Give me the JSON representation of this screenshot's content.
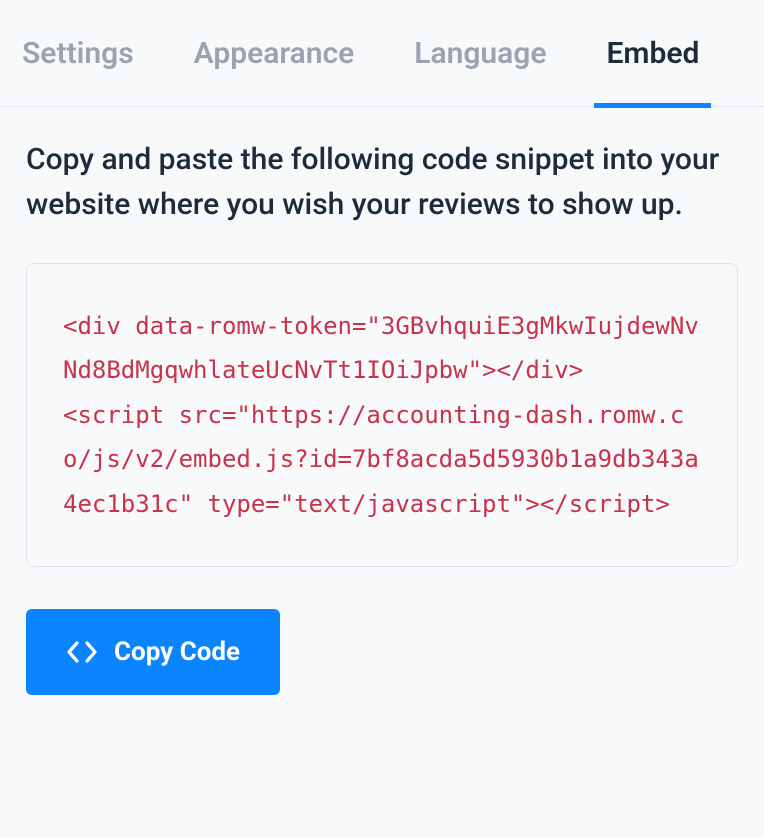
{
  "tabs": {
    "settings": "Settings",
    "appearance": "Appearance",
    "language": "Language",
    "embed": "Embed"
  },
  "instructions": "Copy and paste the following code snippet into your website where you wish your reviews to show up.",
  "code_snippet": "<div data-romw-token=\"3GBvhquiE3gMkwIujdewNvNd8BdMgqwhlateUcNvTt1IOiJpbw\"></div>\n<script src=\"https://accounting-dash.romw.co/js/v2/embed.js?id=7bf8acda5d5930b1a9db343a4ec1b31c\" type=\"text/javascript\"></​script>",
  "copy_button_label": "Copy Code",
  "colors": {
    "accent": "#0a84ff",
    "code_text": "#c9324a"
  }
}
